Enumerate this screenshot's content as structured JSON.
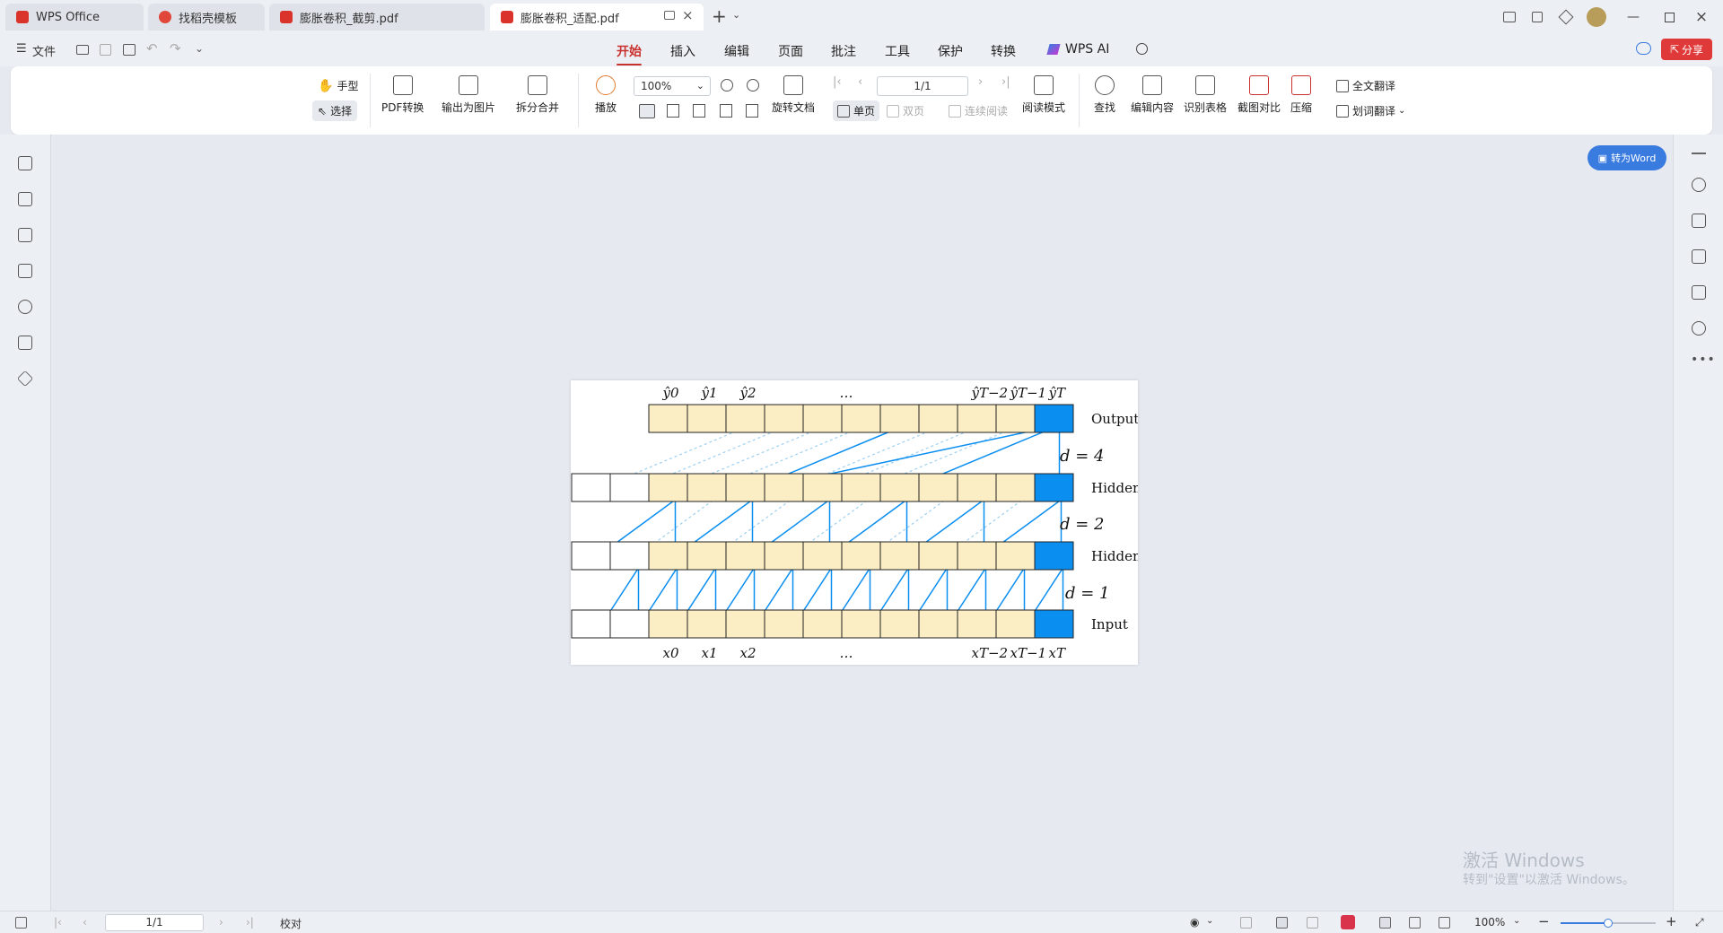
{
  "tabs": [
    {
      "label": "WPS Office",
      "color": "#d9332b"
    },
    {
      "label": "找稻壳模板",
      "color": "#e0473a"
    },
    {
      "label": "膨胀卷积_截剪.pdf",
      "color": "#d9332b"
    },
    {
      "label": "膨胀卷积_适配.pdf",
      "color": "#d9332b",
      "active": true
    }
  ],
  "menu": {
    "file_label": "文件",
    "items": [
      "开始",
      "插入",
      "编辑",
      "页面",
      "批注",
      "工具",
      "保护",
      "转换",
      "WPS AI"
    ],
    "active": "开始",
    "share_label": "分享"
  },
  "ribbon": {
    "hand": "手型",
    "select": "选择",
    "pdf_convert": "PDF转换",
    "export_image": "输出为图片",
    "split_merge": "拆分合并",
    "play": "播放",
    "zoom_value": "100%",
    "rotate": "旋转文档",
    "single_page": "单页",
    "double_page": "双页",
    "continuous": "连续阅读",
    "read_mode": "阅读模式",
    "find": "查找",
    "edit_content": "编辑内容",
    "recognize_table": "识别表格",
    "compare": "截图对比",
    "compress": "压缩",
    "full_translate": "全文翻译",
    "word_translate": "划词翻译",
    "page_indicator": "1/1"
  },
  "to_word": "转为Word",
  "figure": {
    "top_labels": [
      "ŷ0",
      "ŷ1",
      "ŷ2",
      "…",
      "ŷT−2",
      "ŷT−1",
      "ŷT"
    ],
    "bottom_labels": [
      "x0",
      "x1",
      "x2",
      "…",
      "xT−2",
      "xT−1",
      "xT"
    ],
    "row_labels": [
      "Output",
      "Hidden",
      "Hidden",
      "Input"
    ],
    "dilation_labels": [
      "d = 4",
      "d = 2",
      "d = 1"
    ],
    "cell_color": "#fbeec4",
    "accent_color": "#0a8ef0"
  },
  "watermark": {
    "line1": "激活 Windows",
    "line2": "转到\"设置\"以激活 Windows。"
  },
  "status": {
    "page": "1/1",
    "proofread": "校对",
    "zoom": "100%",
    "zoom_level": 0.5
  }
}
